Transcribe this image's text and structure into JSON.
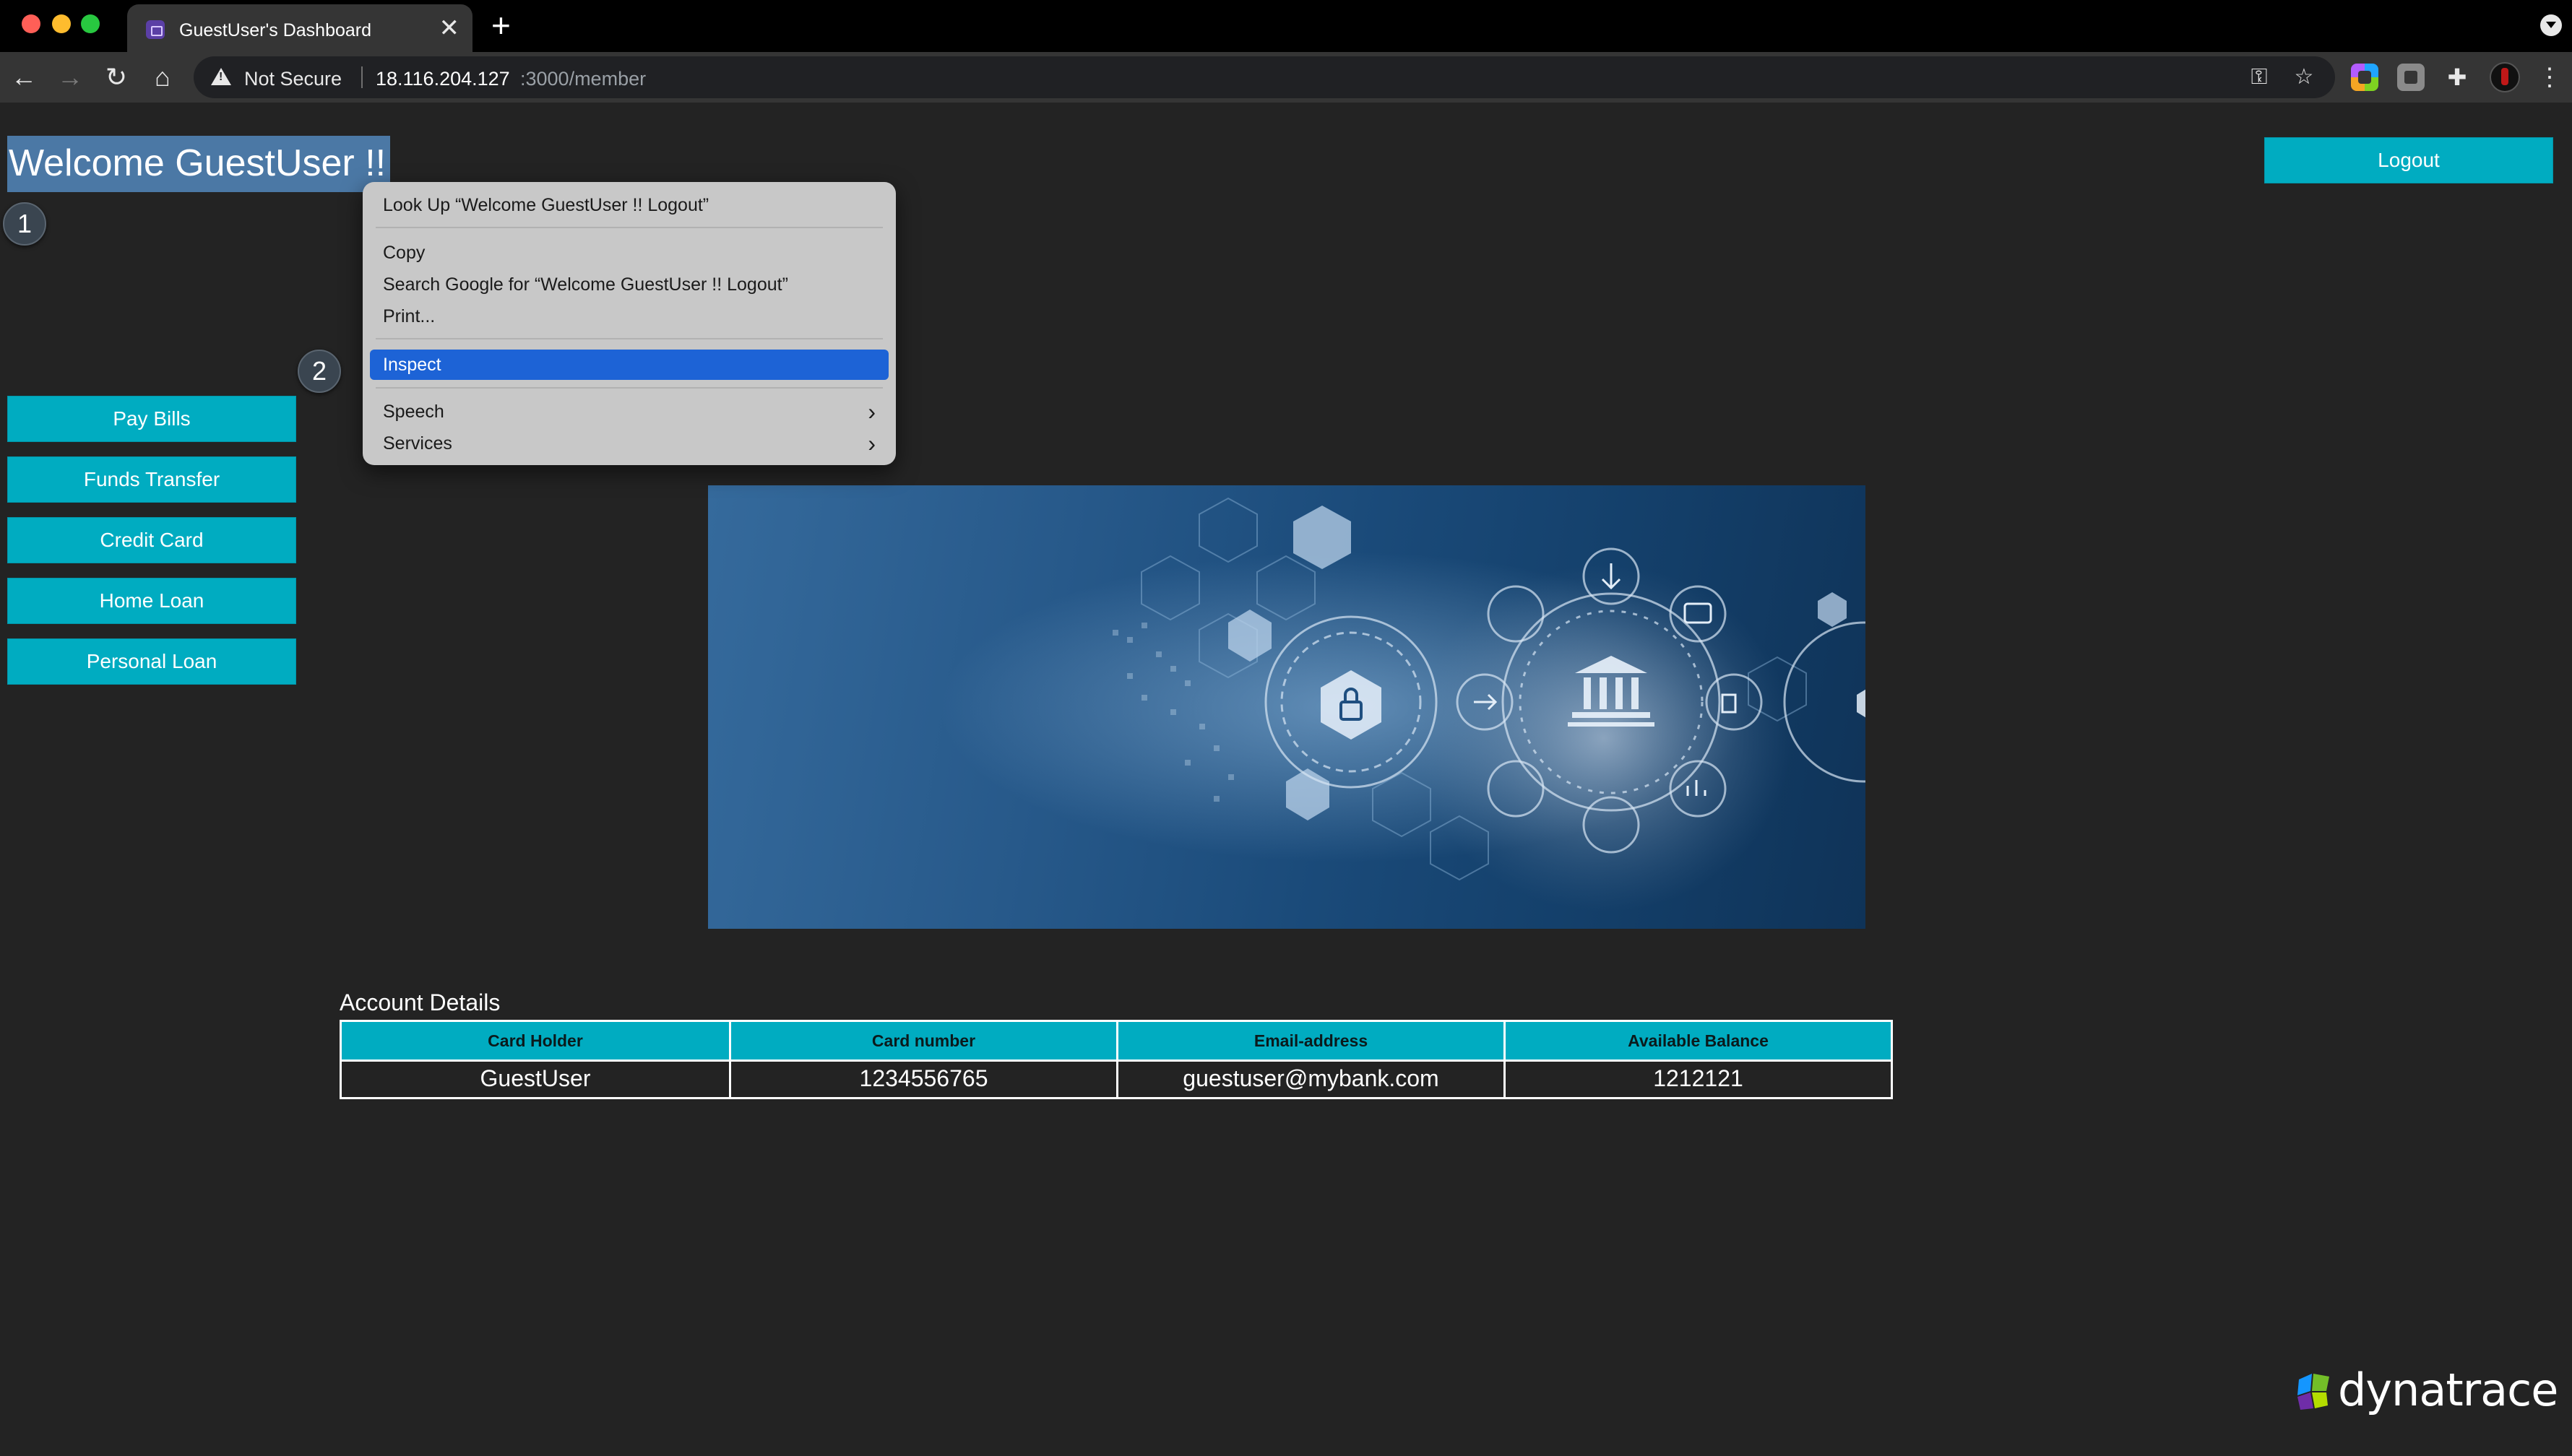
{
  "browser": {
    "tab_title": "GuestUser's Dashboard",
    "tab_close": "✕",
    "new_tab": "+",
    "security_label": "Not Secure",
    "url_host": "18.116.204.127",
    "url_path": ":3000/member"
  },
  "header": {
    "welcome": "Welcome GuestUser !!",
    "logout_label": "Logout"
  },
  "steps": [
    "1",
    "2"
  ],
  "sidebar": {
    "items": [
      {
        "label": "Pay Bills"
      },
      {
        "label": "Funds Transfer"
      },
      {
        "label": "Credit Card"
      },
      {
        "label": "Home Loan"
      },
      {
        "label": "Personal Loan"
      }
    ]
  },
  "context_menu": {
    "look_up": "Look Up “Welcome GuestUser !!  Logout”",
    "copy": "Copy",
    "search_google": "Search Google for “Welcome GuestUser !!  Logout”",
    "print": "Print...",
    "inspect": "Inspect",
    "speech": "Speech",
    "services": "Services"
  },
  "account": {
    "title": "Account Details",
    "columns": [
      "Card Holder",
      "Card number",
      "Email-address",
      "Available Balance"
    ],
    "row": [
      "GuestUser",
      "1234556765",
      "guestuser@mybank.com",
      "1212121"
    ]
  },
  "branding": {
    "logo_text": "dynatrace"
  },
  "colors": {
    "accent": "#00acc1",
    "page_background": "#232323",
    "selection": "#4b78a5",
    "menu_highlight": "#1d63d6"
  }
}
